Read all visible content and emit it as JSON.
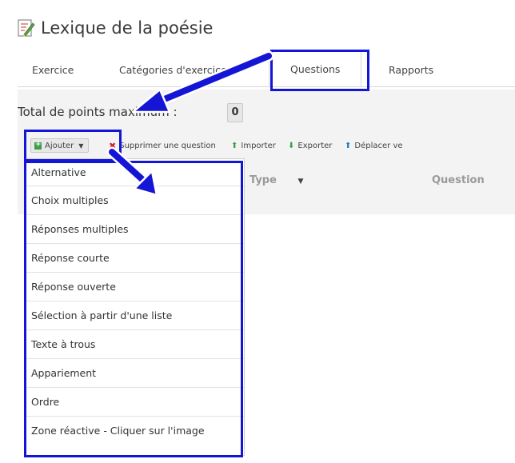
{
  "app": {
    "title": "Lexique de la poésie"
  },
  "tabs": [
    {
      "label": "Exercice"
    },
    {
      "label": "Catégories d'exercice"
    },
    {
      "label": "Questions",
      "active": true
    },
    {
      "label": "Rapports"
    }
  ],
  "points": {
    "label": "Total de points maximum :",
    "value": "0"
  },
  "toolbar": {
    "add_label": "Ajouter",
    "delete_label": "Supprimer une question",
    "import_label": "Importer",
    "export_label": "Exporter",
    "move_label": "Déplacer ve"
  },
  "table": {
    "columns": [
      "Type",
      "Question"
    ]
  },
  "dropdown": {
    "items": [
      "Alternative",
      "Choix multiples",
      "Réponses multiples",
      "Réponse courte",
      "Réponse ouverte",
      "Sélection à partir d'une liste",
      "Texte à trous",
      "Appariement",
      "Ordre",
      "Zone réactive - Cliquer sur l'image"
    ]
  },
  "colors": {
    "highlight": "#1515d6",
    "add_icon": "#3b9d45",
    "delete_icon": "#d62020",
    "import_icon": "#3b9d45",
    "export_icon": "#3b9d45",
    "move_icon": "#1e7fc8"
  }
}
